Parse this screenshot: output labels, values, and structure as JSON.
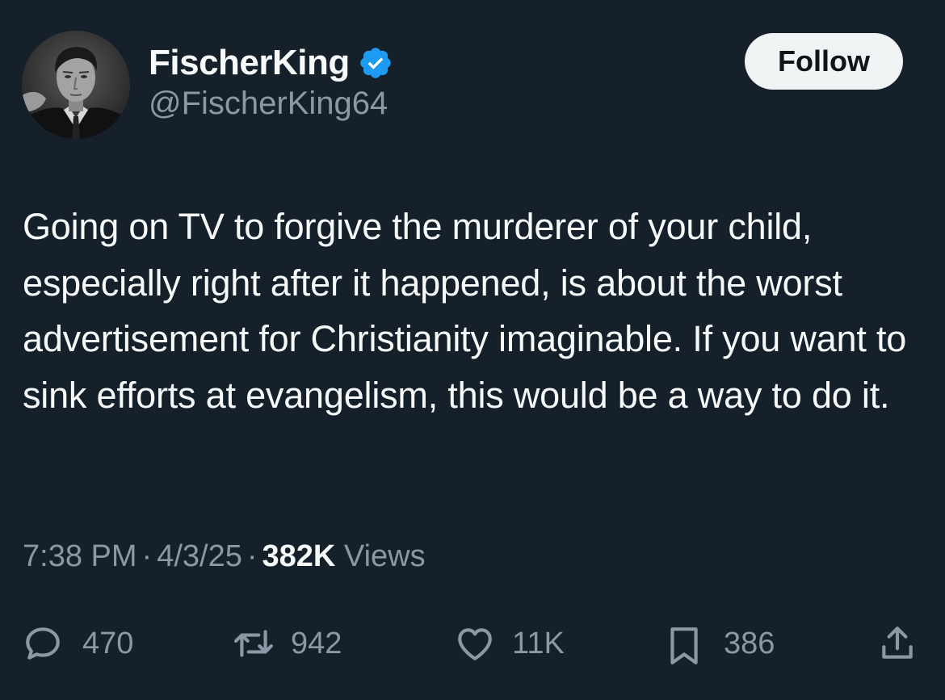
{
  "author": {
    "display_name": "FischerKing",
    "handle": "@FischerKing64",
    "verified": true,
    "avatar_icon": "avatar-photo"
  },
  "follow_label": "Follow",
  "tweet": {
    "text": "Going on TV to forgive the murderer of your child, especially right after it happened, is about the worst advertisement for Christianity imaginable. If you want to sink efforts at evangelism, this would be a way to do it."
  },
  "meta": {
    "time": "7:38 PM",
    "date": "4/3/25",
    "separator": "·",
    "views_count": "382K",
    "views_label": "Views"
  },
  "actions": {
    "replies": "470",
    "reposts": "942",
    "likes": "11K",
    "bookmarks": "386"
  },
  "colors": {
    "background": "#15202b",
    "text_primary": "#f7f9f9",
    "text_secondary": "#8b98a5",
    "verified_badge": "#1d9bf0",
    "follow_button_bg": "#eff3f4"
  }
}
